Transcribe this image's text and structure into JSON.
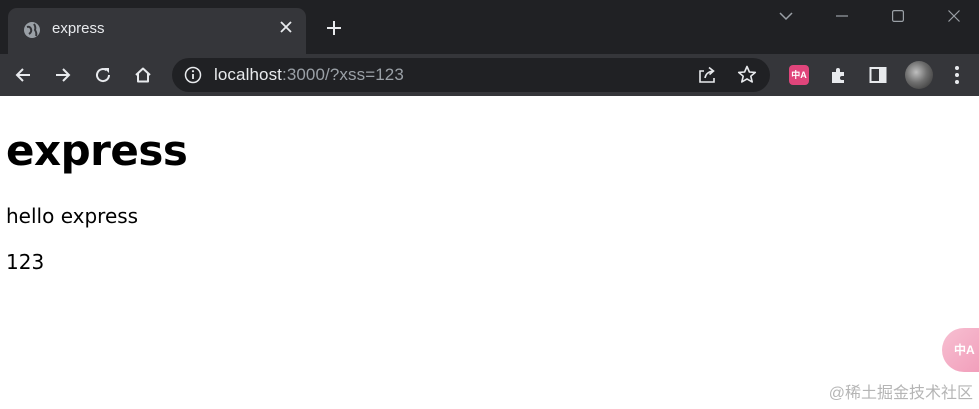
{
  "tab": {
    "title": "express",
    "close_glyph": "✕",
    "new_tab_glyph": "+"
  },
  "window_controls": {
    "dropdown": "⌄",
    "minimize": "—",
    "maximize": "☐",
    "close": "✕"
  },
  "address_bar": {
    "host": "localhost",
    "rest": ":3000/?xss=123"
  },
  "extensions": {
    "translate_label": "中A"
  },
  "page": {
    "heading": "express",
    "paragraphs": [
      "hello express",
      "123"
    ]
  },
  "floating_widget": {
    "label": "中A"
  },
  "watermark": "@稀土掘金技术社区",
  "colors": {
    "titlebar": "#202124",
    "toolbar": "#35363a",
    "accent": "#e0457b"
  }
}
